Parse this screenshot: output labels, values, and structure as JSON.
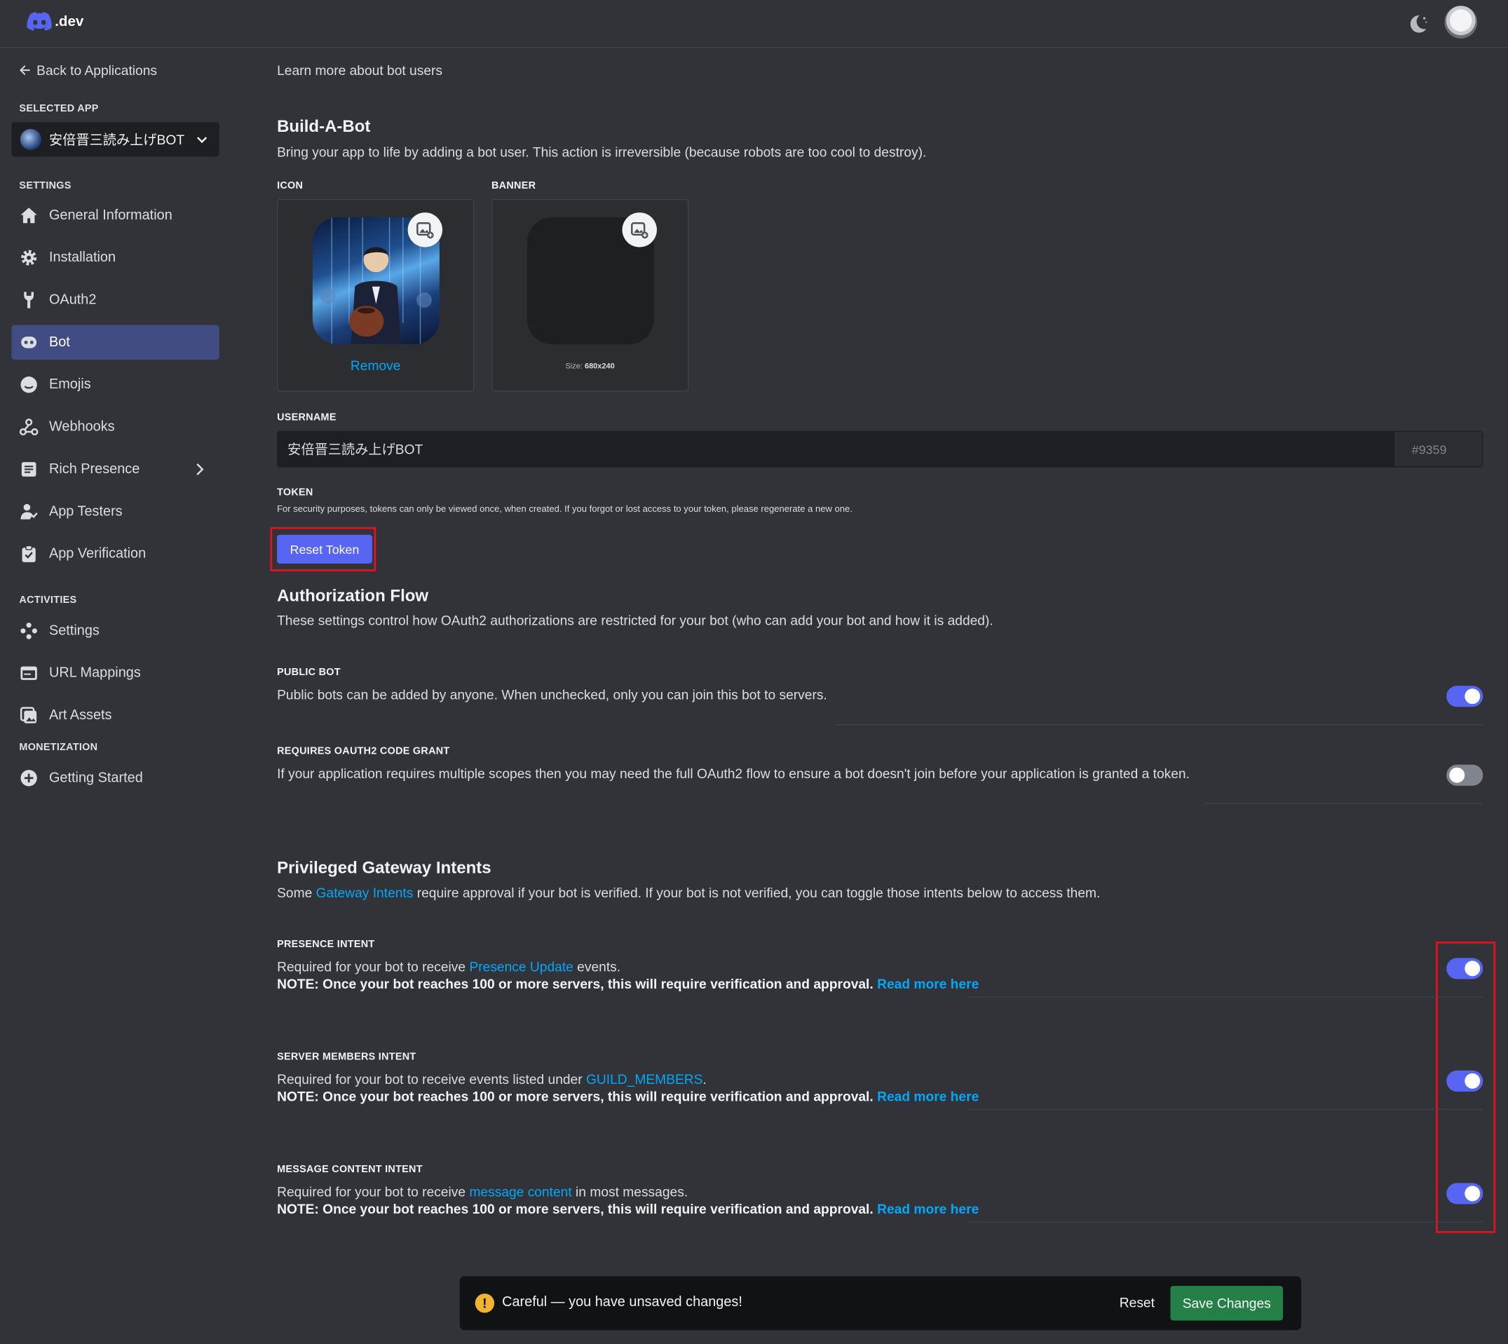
{
  "header": {
    "logo_text": ".dev"
  },
  "sidebar": {
    "back_label": "Back to Applications",
    "selected_app_label": "SELECTED APP",
    "selected_app_name": "安倍晋三読み上げBOT",
    "settings_label": "SETTINGS",
    "items": [
      {
        "label": "General Information",
        "icon": "home-icon"
      },
      {
        "label": "Installation",
        "icon": "gear-icon"
      },
      {
        "label": "OAuth2",
        "icon": "wrench-icon"
      },
      {
        "label": "Bot",
        "icon": "bot-icon",
        "active": true
      },
      {
        "label": "Emojis",
        "icon": "smile-icon"
      },
      {
        "label": "Webhooks",
        "icon": "webhook-icon"
      },
      {
        "label": "Rich Presence",
        "icon": "document-icon"
      },
      {
        "label": "App Testers",
        "icon": "person-icon"
      },
      {
        "label": "App Verification",
        "icon": "clipboard-check-icon"
      }
    ],
    "activities_label": "ACTIVITIES",
    "activities": [
      {
        "label": "Settings",
        "icon": "gamepad-icon"
      },
      {
        "label": "URL Mappings",
        "icon": "browser-icon"
      },
      {
        "label": "Art Assets",
        "icon": "images-icon"
      }
    ],
    "monetization_label": "MONETIZATION",
    "monetization": [
      {
        "label": "Getting Started",
        "icon": "plus-circle-icon"
      }
    ]
  },
  "main": {
    "learn_more": "Learn more about bot users",
    "build_title": "Build-A-Bot",
    "build_desc": "Bring your app to life by adding a bot user. This action is irreversible (because robots are too cool to destroy).",
    "icon_label": "ICON",
    "banner_label": "BANNER",
    "remove_label": "Remove",
    "size_prefix": "Size:",
    "size_value": "680x240",
    "username_label": "USERNAME",
    "username_value": "安倍晋三読み上げBOT",
    "discriminator": "#9359",
    "token_label": "TOKEN",
    "token_desc": "For security purposes, tokens can only be viewed once, when created. If you forgot or lost access to your token, please regenerate a new one.",
    "reset_token_label": "Reset Token",
    "auth_title": "Authorization Flow",
    "auth_desc": "These settings control how OAuth2 authorizations are restricted for your bot (who can add your bot and how it is added).",
    "public_bot_label": "PUBLIC BOT",
    "public_bot_desc": "Public bots can be added by anyone. When unchecked, only you can join this bot to servers.",
    "public_bot_on": true,
    "code_grant_label": "REQUIRES OAUTH2 CODE GRANT",
    "code_grant_desc": "If your application requires multiple scopes then you may need the full OAuth2 flow to ensure a bot doesn't join before your application is granted a token.",
    "code_grant_on": false,
    "intents_title": "Privileged Gateway Intents",
    "intents_desc_pre": "Some",
    "intents_desc_link": "Gateway Intents",
    "intents_desc_post": "require approval if your bot is verified. If your bot is not verified, you can toggle those intents below to access them.",
    "note_text": "NOTE: Once your bot reaches 100 or more servers, this will require verification and approval.",
    "read_more": "Read more here",
    "presence_label": "PRESENCE INTENT",
    "presence_pre": "Required for your bot to receive",
    "presence_link": "Presence Update",
    "presence_post": "events.",
    "presence_on": true,
    "members_label": "SERVER MEMBERS INTENT",
    "members_pre": "Required for your bot to receive events listed under",
    "members_link": "GUILD_MEMBERS",
    "members_post": ".",
    "members_on": true,
    "message_label": "MESSAGE CONTENT INTENT",
    "message_pre": "Required for your bot to receive",
    "message_link": "message content",
    "message_post": "in most messages.",
    "message_on": true
  },
  "notice": {
    "text": "Careful — you have unsaved changes!",
    "reset_label": "Reset",
    "save_label": "Save Changes"
  },
  "colors": {
    "accent": "#5865f2",
    "link": "#00a8fc",
    "save": "#248046",
    "highlight": "#e4121f"
  }
}
